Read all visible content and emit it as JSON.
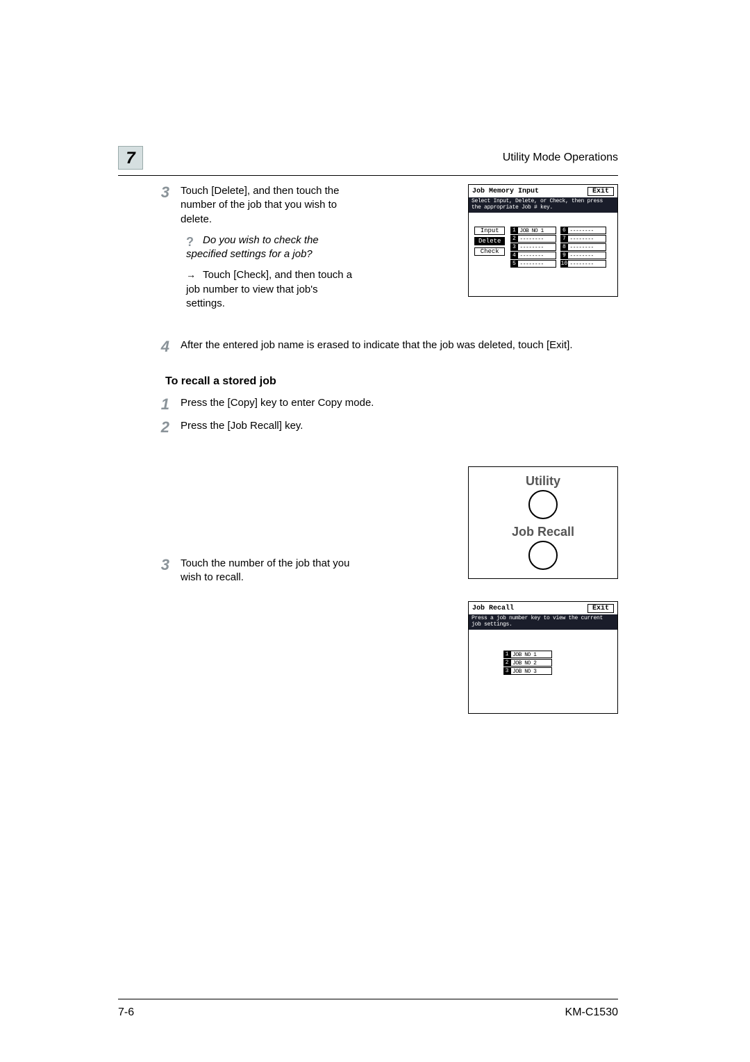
{
  "header": {
    "chapter": "7",
    "title": "Utility Mode Operations"
  },
  "step3": {
    "num": "3",
    "text": "Touch [Delete], and then touch the number of the job that you wish to delete.",
    "tip": "Do you wish to check the specified settings for a job?",
    "arrow_text": "Touch [Check], and then touch a job number to view that job's settings."
  },
  "step4": {
    "num": "4",
    "text": "After the entered job name is erased to indicate that the job was deleted, touch [Exit]."
  },
  "subhead1": "To recall a stored job",
  "r1": {
    "num": "1",
    "text": "Press the [Copy] key to enter Copy mode."
  },
  "r2": {
    "num": "2",
    "text": "Press the [Job Recall] key."
  },
  "r3": {
    "num": "3",
    "text": "Touch the number of the job that you wish to recall."
  },
  "screen1": {
    "title": "Job Memory Input",
    "exit": "Exit",
    "msg": "Select Input, Delete, or Check, then press the appropriate Job # key.",
    "btn_input": "Input",
    "btn_delete": "Delete",
    "btn_check": "Check",
    "jobs_left": [
      "JOB NO 1",
      "--------",
      "--------",
      "--------",
      "--------"
    ],
    "nums_left": [
      "1",
      "2",
      "3",
      "4",
      "5"
    ],
    "jobs_right": [
      "--------",
      "--------",
      "--------",
      "--------",
      "--------"
    ],
    "nums_right": [
      "6",
      "7",
      "8",
      "9",
      "10"
    ]
  },
  "keypanel": {
    "utility": "Utility",
    "jobrecall": "Job Recall"
  },
  "screen3": {
    "title": "Job Recall",
    "exit": "Exit",
    "msg": "Press a job number key to view the current job settings.",
    "jobs": [
      "JOB NO 1",
      "JOB NO 2",
      "JOB NO 3"
    ],
    "nums": [
      "1",
      "2",
      "3"
    ]
  },
  "footer": {
    "page": "7-6",
    "model": "KM-C1530"
  }
}
